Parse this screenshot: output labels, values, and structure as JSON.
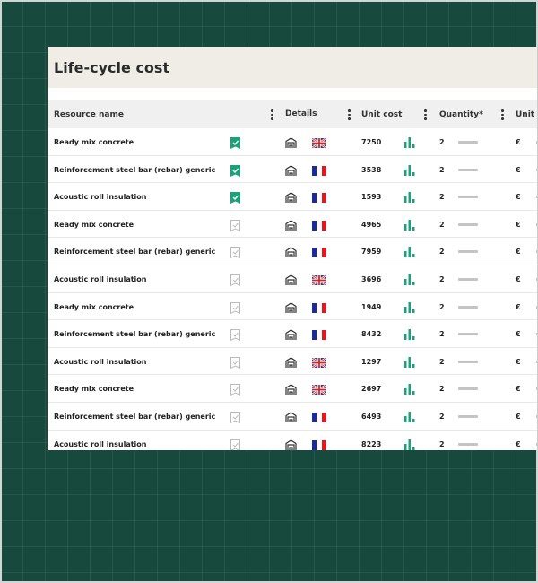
{
  "title": "Life-cycle cost",
  "columns": {
    "resource_name": "Resource name",
    "details": "Details",
    "unit_cost": "Unit cost",
    "quantity": "Quantity*",
    "unit": "Unit"
  },
  "colors": {
    "accent": "#1aa37a",
    "background": "#174a3c",
    "header_bg": "#f0ede6"
  },
  "rows": [
    {
      "name": "Ready mix concrete",
      "verified": true,
      "flag": "uk",
      "cost": "7250",
      "qty": "2",
      "unit": "€"
    },
    {
      "name": "Reinforcement steel bar  (rebar) generic",
      "verified": true,
      "flag": "fr",
      "cost": "3538",
      "qty": "2",
      "unit": "€"
    },
    {
      "name": "Acoustic roll insulation",
      "verified": true,
      "flag": "fr",
      "cost": "1593",
      "qty": "2",
      "unit": "€"
    },
    {
      "name": "Ready mix concrete",
      "verified": false,
      "flag": "fr",
      "cost": "4965",
      "qty": "2",
      "unit": "€"
    },
    {
      "name": "Reinforcement steel bar  (rebar) generic",
      "verified": false,
      "flag": "fr",
      "cost": "7959",
      "qty": "2",
      "unit": "€"
    },
    {
      "name": "Acoustic roll insulation",
      "verified": false,
      "flag": "uk",
      "cost": "3696",
      "qty": "2",
      "unit": "€"
    },
    {
      "name": "Ready mix concrete",
      "verified": false,
      "flag": "fr",
      "cost": "1949",
      "qty": "2",
      "unit": "€"
    },
    {
      "name": "Reinforcement steel bar  (rebar) generic",
      "verified": false,
      "flag": "fr",
      "cost": "8432",
      "qty": "2",
      "unit": "€"
    },
    {
      "name": "Acoustic roll insulation",
      "verified": false,
      "flag": "uk",
      "cost": "1297",
      "qty": "2",
      "unit": "€"
    },
    {
      "name": "Ready mix concrete",
      "verified": false,
      "flag": "uk",
      "cost": "2697",
      "qty": "2",
      "unit": "€"
    },
    {
      "name": "Reinforcement steel bar  (rebar) generic",
      "verified": false,
      "flag": "fr",
      "cost": "6493",
      "qty": "2",
      "unit": "€"
    },
    {
      "name": "Acoustic roll insulation",
      "verified": false,
      "flag": "fr",
      "cost": "8223",
      "qty": "2",
      "unit": "€"
    }
  ]
}
